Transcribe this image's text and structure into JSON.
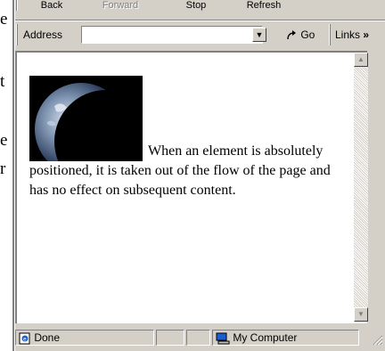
{
  "background_page": {
    "fragments": [
      "e",
      "t",
      "e",
      "r"
    ]
  },
  "toolbar": {
    "buttons": [
      {
        "label": "Back",
        "enabled": true
      },
      {
        "label": "Forward",
        "enabled": false
      },
      {
        "label": "Stop",
        "enabled": true
      },
      {
        "label": "Refresh",
        "enabled": true
      }
    ]
  },
  "address_bar": {
    "label": "Address",
    "value": "",
    "go_label": "Go",
    "links_label": "Links",
    "chevron": "»"
  },
  "page": {
    "image": "earth-image",
    "paragraph": "When an element is absolutely positioned, it is taken out of the flow of the page and has no effect on subsequent content."
  },
  "status_bar": {
    "status": "Done",
    "zone": "My Computer"
  },
  "colors": {
    "chrome": "#d4d0c8",
    "shadow": "#808080",
    "highlight": "#ffffff",
    "page_bg": "#ffffff"
  }
}
